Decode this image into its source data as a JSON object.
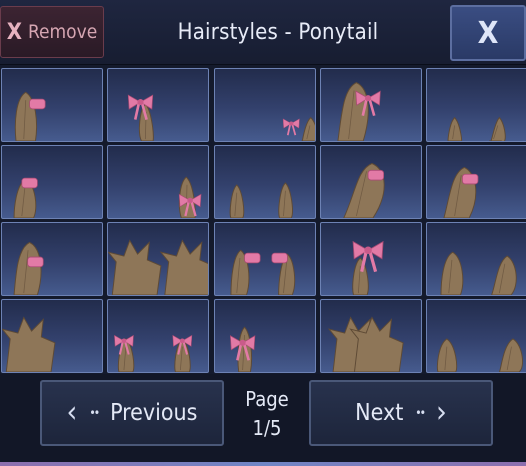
{
  "header": {
    "remove_label": "Remove",
    "remove_icon": "x-mark",
    "title": "Hairstyles - Ponytail",
    "close_icon": "close-x"
  },
  "grid": {
    "rows": 4,
    "cols": 5,
    "cell_content": "ponytail hairstyle thumbnails (brown hair, some with pink ribbons/bows)"
  },
  "footer": {
    "prev_label": "Previous",
    "next_label": "Next",
    "page_label": "Page",
    "page_indicator": "1/5"
  },
  "colors": {
    "hair": "#8e7658",
    "ribbon": "#e27aa6",
    "cell_border": "#6d82b4",
    "header_bg": "#1b2238"
  }
}
